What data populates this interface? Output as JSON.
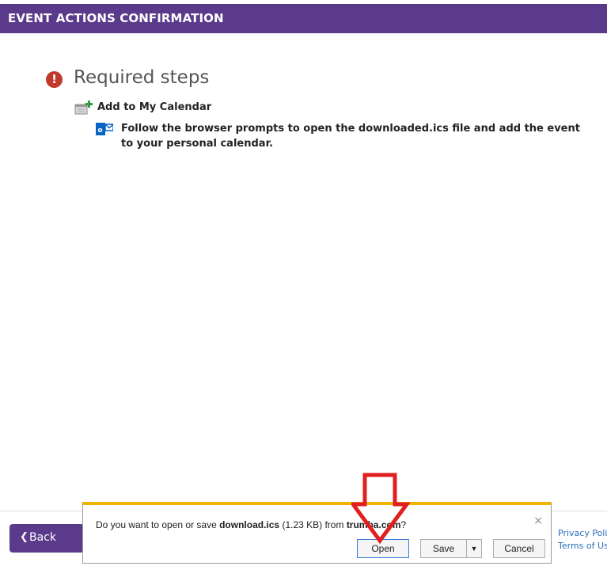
{
  "header": {
    "title": "EVENT ACTIONS CONFIRMATION"
  },
  "required": {
    "icon": "exclamation-icon",
    "title": "Required steps"
  },
  "steps": [
    {
      "icon": "calendar-add-icon",
      "label": "Add to My Calendar",
      "sub_icon": "outlook-icon",
      "description": "Follow the browser prompts to open the downloaded.ics file and add the event to your personal calendar."
    }
  ],
  "footer": {
    "back_label": "Back",
    "privacy_label": "Privacy Policy",
    "terms_label": "Terms of Use"
  },
  "download_bar": {
    "prefix": "Do you want to open or save ",
    "filename": "download.ics",
    "size": " (1.23 KB) from ",
    "source": "trumba.com",
    "suffix": "?",
    "open_label": "Open",
    "save_label": "Save",
    "cancel_label": "Cancel",
    "close_glyph": "×",
    "dropdown_glyph": "▼"
  },
  "colors": {
    "brand_purple": "#5b3a8c",
    "alert_red": "#c0392b",
    "annotation_red": "#e02020",
    "download_bar_accent": "#f0b400",
    "link_blue": "#2a6ebb"
  }
}
